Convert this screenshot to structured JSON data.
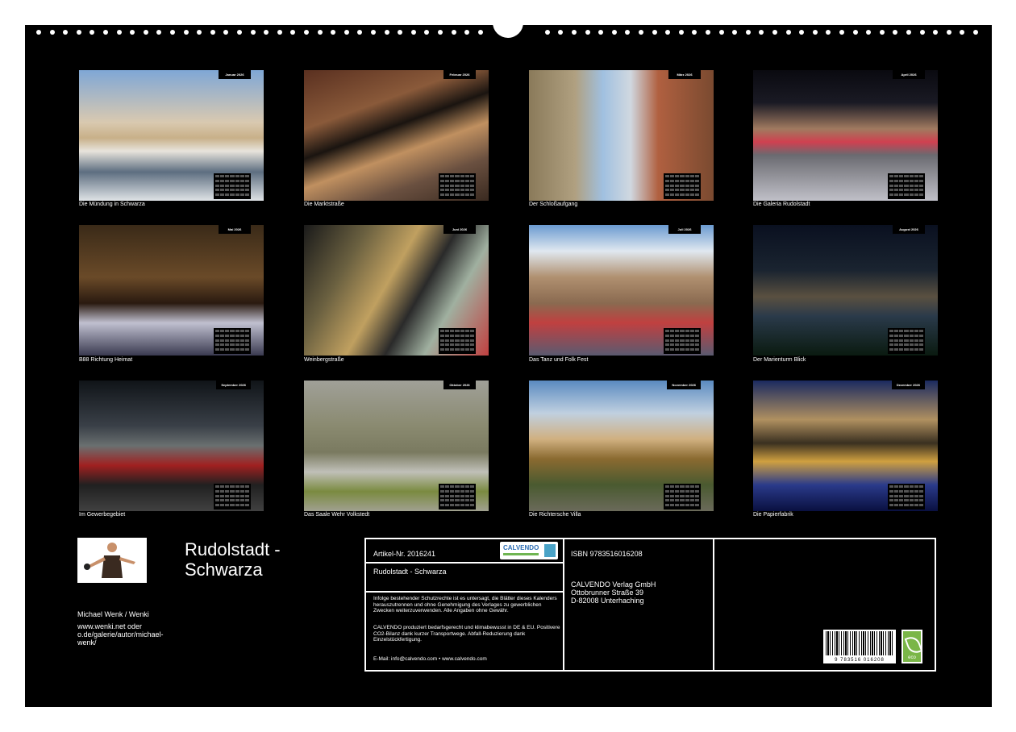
{
  "title": {
    "line1": "Rudolstadt -",
    "line2": "Schwarza"
  },
  "author": {
    "name": "Michael Wenk / Wenki",
    "website_line1": "www.wenki.net  oder",
    "website_line2": "o.de/galerie/autor/michael-",
    "website_line3": "wenk/"
  },
  "months": [
    {
      "tag": "Januar 2026",
      "caption": "Die Mündung in Schwarza"
    },
    {
      "tag": "Februar 2026",
      "caption": "Die Marktstraße"
    },
    {
      "tag": "März 2026",
      "caption": "Der Schloßaufgang"
    },
    {
      "tag": "April 2026",
      "caption": "Die Galeria Rudolstadt"
    },
    {
      "tag": "Mai 2026",
      "caption": "B88 Richtung Heimat"
    },
    {
      "tag": "Juni 2026",
      "caption": "Weinbergstraße"
    },
    {
      "tag": "Juli 2026",
      "caption": "Das Tanz und Folk Fest"
    },
    {
      "tag": "August 2026",
      "caption": "Der Marienturm Blick"
    },
    {
      "tag": "September 2026",
      "caption": "Im Gewerbegebiet"
    },
    {
      "tag": "Oktober 2026",
      "caption": "Das Saale Wehr Volkstedt"
    },
    {
      "tag": "November 2026",
      "caption": "Die Richtersche Villa"
    },
    {
      "tag": "Dezember 2026",
      "caption": "Die Papierfabrik"
    }
  ],
  "info": {
    "article": "Artikel-Nr. 2016241",
    "calvendo_logo": "CALVENDO",
    "product_title": "Rudolstadt - Schwarza",
    "notice1": "Infolge bestehender Schutzrechte ist es untersagt, die Blätter dieses Kalenders herauszutrennen und ohne Genehmigung des Verlages zu gewerblichen Zwecken weiterzuverwenden. Alle Angaben ohne Gewähr.",
    "notice2": "CALVENDO produziert bedarfsgerecht und klimabewusst in DE & EU. Positivere CO2-Bilanz dank kurzer Transportwege. Abfall-Reduzierung dank Einzelstückfertigung.",
    "email": "E-Mail: info@calvendo.com • www.calvendo.com",
    "isbn": "ISBN 9783516016208",
    "publisher1": "CALVENDO Verlag GmbH",
    "publisher2": "Ottobrunner Straße 39",
    "publisher3": "D-82008 Unterhaching",
    "barcode_number": "9 783516 016208",
    "eco_label": "eco"
  }
}
